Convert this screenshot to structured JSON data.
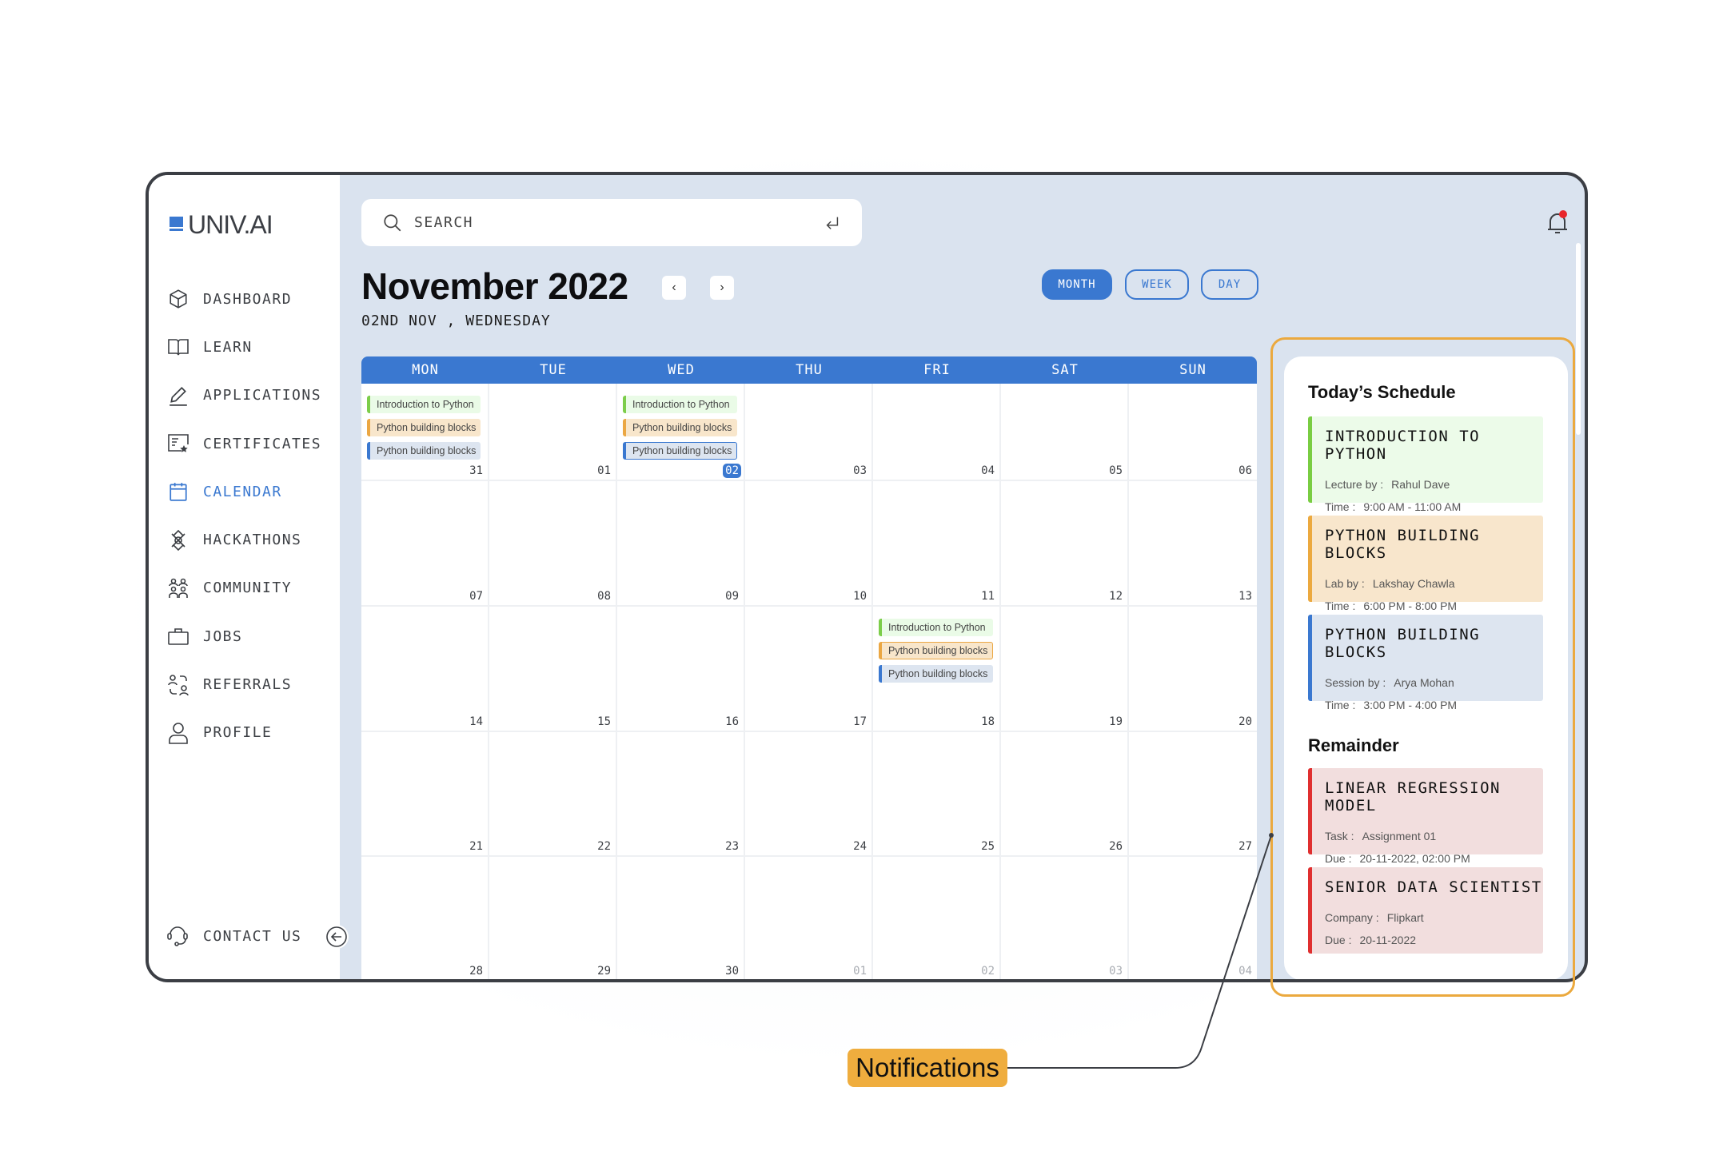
{
  "app": {
    "brand": "UNIV.AI",
    "accent": "#3a78d0"
  },
  "sidebar": {
    "items": [
      {
        "label": "DASHBOARD",
        "icon": "cube-icon"
      },
      {
        "label": "LEARN",
        "icon": "book-icon"
      },
      {
        "label": "APPLICATIONS",
        "icon": "pencil-icon"
      },
      {
        "label": "CERTIFICATES",
        "icon": "certificate-icon"
      },
      {
        "label": "CALENDAR",
        "icon": "calendar-icon",
        "active": true
      },
      {
        "label": "HACKATHONS",
        "icon": "hackathon-icon"
      },
      {
        "label": "COMMUNITY",
        "icon": "community-icon"
      },
      {
        "label": "JOBS",
        "icon": "briefcase-icon"
      },
      {
        "label": "REFERRALS",
        "icon": "referrals-icon"
      },
      {
        "label": "PROFILE",
        "icon": "user-icon"
      }
    ],
    "contact": {
      "label": "CONTACT US",
      "icon": "headset-icon"
    },
    "collapse_icon": "arrow-left-circle-icon"
  },
  "header": {
    "search_placeholder": "SEARCH",
    "search_icon": "search-icon",
    "enter_icon": "enter-icon",
    "notification_icon": "bell-icon",
    "has_unread": true
  },
  "calendar": {
    "title": "November 2022",
    "prev_label": "‹",
    "next_label": "›",
    "subtitle": "02ND NOV , WEDNESDAY",
    "views": [
      {
        "label": "MONTH",
        "active": true
      },
      {
        "label": "WEEK",
        "active": false
      },
      {
        "label": "DAY",
        "active": false
      }
    ],
    "weekdays": [
      "MON",
      "TUE",
      "WED",
      "THU",
      "FRI",
      "SAT",
      "SUN"
    ],
    "weeks": [
      [
        {
          "day": "31",
          "other": false,
          "events": [
            {
              "title": "Introduction to Python",
              "color": "green"
            },
            {
              "title": "Python building blocks",
              "color": "orange"
            },
            {
              "title": "Python building blocks",
              "color": "blue"
            }
          ]
        },
        {
          "day": "01",
          "events": []
        },
        {
          "day": "02",
          "today": true,
          "events": [
            {
              "title": "Introduction to Python",
              "color": "green"
            },
            {
              "title": "Python building blocks",
              "color": "orange"
            },
            {
              "title": "Python building blocks",
              "color": "blue",
              "outlined": true
            }
          ]
        },
        {
          "day": "03",
          "events": []
        },
        {
          "day": "04",
          "events": []
        },
        {
          "day": "05",
          "events": []
        },
        {
          "day": "06",
          "events": []
        }
      ],
      [
        {
          "day": "07",
          "events": []
        },
        {
          "day": "08",
          "events": []
        },
        {
          "day": "09",
          "events": []
        },
        {
          "day": "10",
          "events": []
        },
        {
          "day": "11",
          "events": []
        },
        {
          "day": "12",
          "events": []
        },
        {
          "day": "13",
          "events": []
        }
      ],
      [
        {
          "day": "14",
          "events": []
        },
        {
          "day": "15",
          "events": []
        },
        {
          "day": "16",
          "events": []
        },
        {
          "day": "17",
          "events": []
        },
        {
          "day": "18",
          "events": [
            {
              "title": "Introduction to Python",
              "color": "green"
            },
            {
              "title": "Python building blocks",
              "color": "orange",
              "outlined": true
            },
            {
              "title": "Python building blocks",
              "color": "blue"
            }
          ]
        },
        {
          "day": "19",
          "events": []
        },
        {
          "day": "20",
          "events": []
        }
      ],
      [
        {
          "day": "21",
          "events": []
        },
        {
          "day": "22",
          "events": []
        },
        {
          "day": "23",
          "events": []
        },
        {
          "day": "24",
          "events": []
        },
        {
          "day": "25",
          "events": []
        },
        {
          "day": "26",
          "events": []
        },
        {
          "day": "27",
          "events": []
        }
      ],
      [
        {
          "day": "28",
          "events": []
        },
        {
          "day": "29",
          "events": []
        },
        {
          "day": "30",
          "events": []
        },
        {
          "day": "01",
          "other": true,
          "events": []
        },
        {
          "day": "02",
          "other": true,
          "events": []
        },
        {
          "day": "03",
          "other": true,
          "events": []
        },
        {
          "day": "04",
          "other": true,
          "events": []
        }
      ]
    ]
  },
  "schedule": {
    "heading": "Today’s Schedule",
    "items": [
      {
        "title": "INTRODUCTION TO PYTHON",
        "rows": [
          {
            "k": "Lecture by :",
            "v": "Rahul Dave"
          },
          {
            "k": "Time :",
            "v": "9:00 AM - 11:00 AM"
          }
        ],
        "color": "green"
      },
      {
        "title": "PYTHON BUILDING BLOCKS",
        "rows": [
          {
            "k": "Lab by :",
            "v": "Lakshay Chawla"
          },
          {
            "k": "Time :",
            "v": "6:00 PM - 8:00 PM"
          }
        ],
        "color": "orange"
      },
      {
        "title": "PYTHON BUILDING BLOCKS",
        "rows": [
          {
            "k": "Session by :",
            "v": "Arya Mohan"
          },
          {
            "k": "Time :",
            "v": "3:00 PM - 4:00 PM"
          }
        ],
        "color": "blue"
      }
    ]
  },
  "reminder": {
    "heading": "Remainder",
    "items": [
      {
        "title": "LINEAR REGRESSION MODEL",
        "rows": [
          {
            "k": "Task :",
            "v": "Assignment 01"
          },
          {
            "k": "Due :",
            "v": "20-11-2022, 02:00 PM"
          }
        ],
        "color": "red"
      },
      {
        "title": "SENIOR DATA SCIENTIST",
        "rows": [
          {
            "k": "Company :",
            "v": "Flipkart"
          },
          {
            "k": "Due :",
            "v": "20-11-2022"
          }
        ],
        "color": "red"
      }
    ]
  },
  "annotation": {
    "label": "Notifications",
    "color": "#efad3e"
  }
}
